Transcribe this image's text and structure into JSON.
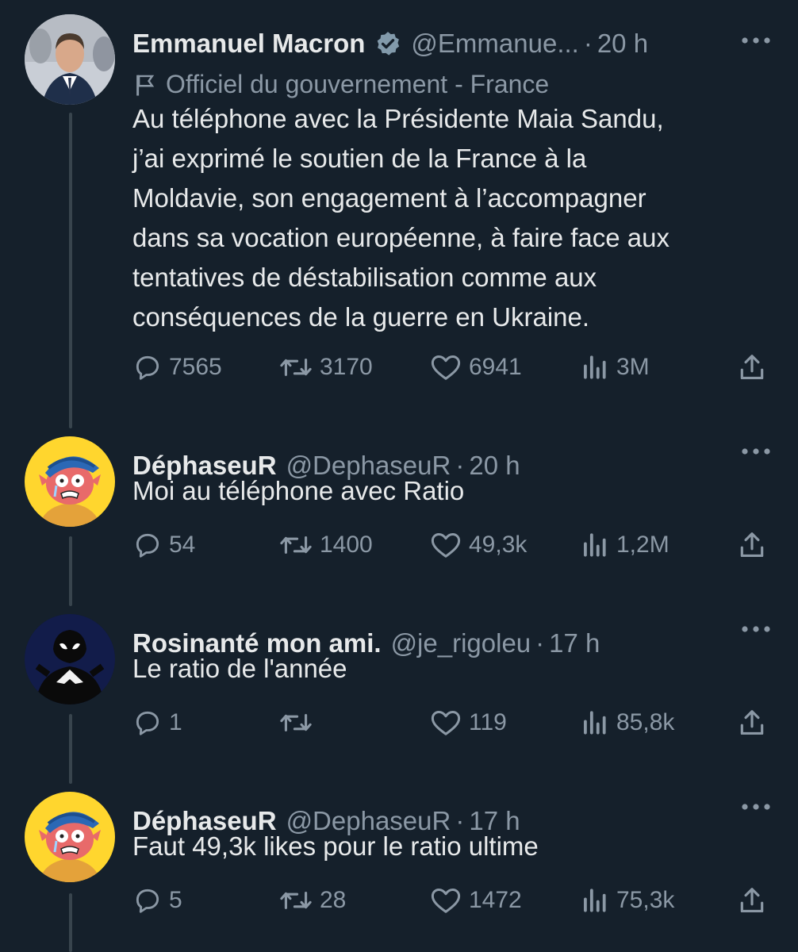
{
  "colors": {
    "background": "#15202b",
    "text": "#e7e9ea",
    "muted": "#8b98a5",
    "thread_line": "#38444d",
    "verified_badge": "#829aab"
  },
  "tweets": [
    {
      "name": "Emmanuel Macron",
      "verified": true,
      "handle": "@Emmanue...",
      "sep": "·",
      "time": "20 h",
      "label": "Officiel du gouvernement - France",
      "label_icon": "flag-icon",
      "text": "Au téléphone avec la Présidente Maia Sandu,\nj’ai exprimé le soutien de la France à la\nMoldavie, son engagement à l’accompagner\ndans sa vocation européenne, à faire face aux\ntentatives de déstabilisation comme aux\nconséquences de la guerre en Ukraine.",
      "replies": "7565",
      "retweets": "3170",
      "likes": "6941",
      "views": "3M"
    },
    {
      "name": "DéphaseuR",
      "handle": "@DephaseuR",
      "sep": "·",
      "time": "20 h",
      "text": "Moi au téléphone avec Ratio",
      "replies": "54",
      "retweets": "1400",
      "likes": "49,3k",
      "views": "1,2M"
    },
    {
      "name": "Rosinanté mon ami.",
      "handle": "@je_rigoleu",
      "sep": "·",
      "time": "17 h",
      "text": "Le ratio de l'année",
      "replies": "1",
      "retweets": "",
      "likes": "119",
      "views": "85,8k"
    },
    {
      "name": "DéphaseuR",
      "handle": "@DephaseuR",
      "sep": "·",
      "time": "17 h",
      "text": "Faut 49,3k likes pour le ratio ultime",
      "replies": "5",
      "retweets": "28",
      "likes": "1472",
      "views": "75,3k"
    }
  ],
  "icons": {
    "reply": "reply-icon",
    "retweet": "retweet-icon",
    "like": "heart-icon",
    "views": "views-icon",
    "share": "share-icon",
    "more": "more-icon",
    "verified": "verified-badge-icon"
  }
}
